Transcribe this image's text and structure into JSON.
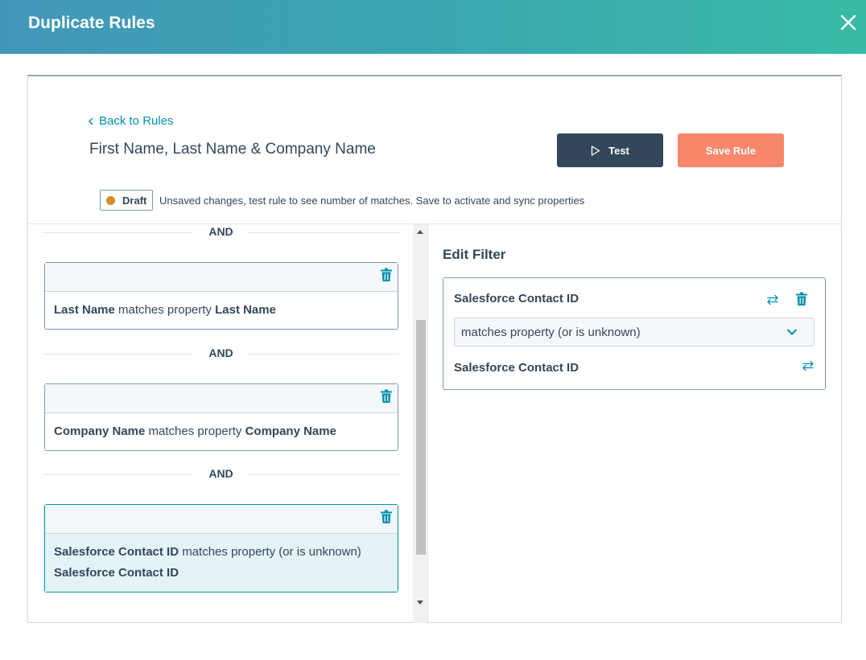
{
  "modal": {
    "title": "Duplicate Rules",
    "close_icon": "close-icon"
  },
  "rule": {
    "back_label": "Back to Rules",
    "title": "First Name, Last Name & Company Name",
    "test_label": "Test",
    "save_label": "Save Rule",
    "status_badge": "Draft",
    "status_message": "Unsaved changes, test rule to see number of matches. Save to activate and sync properties"
  },
  "filters": {
    "and_label": "AND",
    "items": [
      {
        "property": "Last Name",
        "operator": " matches property ",
        "target": "Last Name"
      },
      {
        "property": "Company Name",
        "operator": " matches property ",
        "target": "Company Name"
      },
      {
        "property": "Salesforce Contact ID",
        "operator": " matches property (or is unknown) ",
        "target": "Salesforce Contact ID"
      }
    ]
  },
  "edit_filter": {
    "title": "Edit Filter",
    "source_property": "Salesforce Contact ID",
    "operator_selected": "matches property (or is unknown)",
    "target_property": "Salesforce Contact ID"
  },
  "colors": {
    "accent": "#0091ae",
    "save_button": "#f8876c",
    "test_button": "#33475b",
    "draft_dot": "#d08f24"
  }
}
